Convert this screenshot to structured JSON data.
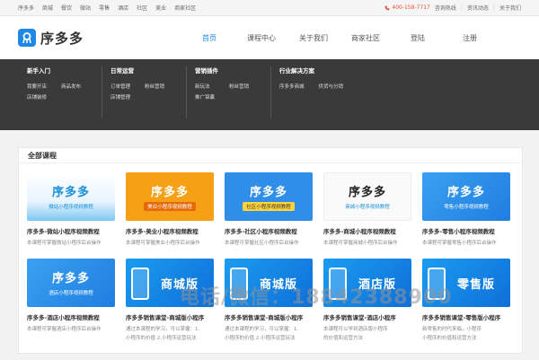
{
  "topbar": {
    "left_links": [
      "序多多",
      "商城",
      "餐饮",
      "微站",
      "零售",
      "酒店",
      "社区",
      "美业",
      "商家社区"
    ],
    "phone": "400-158-7717",
    "right_links": [
      "咨询热线",
      "资讯动态",
      "关于我们"
    ]
  },
  "header": {
    "logo_text": "序多多",
    "nav": [
      "首页",
      "课程中心",
      "关于我们",
      "商家社区",
      "登陆",
      "注册"
    ],
    "active_nav": "首页"
  },
  "mega_menu": {
    "columns": [
      {
        "title": "新手入门",
        "links": [
          "我要开店",
          "商品发布",
          "店铺装修"
        ]
      },
      {
        "title": "日常运营",
        "links": [
          "订单管理",
          "粉丝营销",
          "店铺管理"
        ]
      },
      {
        "title": "营销插件",
        "links": [
          "新玩法",
          "粉丝营销",
          "推广锦囊"
        ]
      },
      {
        "title": "行业解决方案",
        "links": [
          "序多多商城",
          "供货与分销"
        ]
      }
    ]
  },
  "content": {
    "section_title": "全部课程",
    "courses": [
      {
        "thumb_big": "序多多",
        "thumb_sub": "微站小程序视频教程",
        "title": "序多多-微站小程序视频教程",
        "desc": "本课程可掌握微站小程序后台操作",
        "desc2": ""
      },
      {
        "thumb_big": "序多多",
        "thumb_sub": "美业小程序视频教程",
        "title": "序多多-美业小程序视频教程",
        "desc": "本课程可掌握美业小程序后台操作",
        "desc2": ""
      },
      {
        "thumb_big": "序多多",
        "thumb_sub": "社区小程序视频教程",
        "title": "序多多-社区小程序视频教程",
        "desc": "本课程可掌握社区小程序后台操作",
        "desc2": ""
      },
      {
        "thumb_big": "序多多",
        "thumb_sub": "商城小程序视频教程",
        "title": "序多多-商城小程序视频教程",
        "desc": "本课程可掌握商城小程序后台操作",
        "desc2": ""
      },
      {
        "thumb_big": "序多多",
        "thumb_sub": "零售小程序视频教程",
        "title": "序多多-零售小程序视频教程",
        "desc": "本课程可掌握零售小程序后台操作",
        "desc2": ""
      },
      {
        "thumb_big": "序多多",
        "thumb_sub": "酒店小程序视频教程",
        "title": "序多多-酒店小程序视频教程",
        "desc": "本课程可掌握酒店小程序后台操作",
        "desc2": ""
      },
      {
        "thumb_big": "商城版",
        "thumb_sub": "",
        "title": "序多多销售课堂-商城版小程序",
        "desc": "通过本课程的学习，可以掌握：1.",
        "desc2": "小程序的价值 2.小程序运营玩法"
      },
      {
        "thumb_big": "商城版",
        "thumb_sub": "",
        "title": "序多多销售课堂-商城版小程序",
        "desc": "通过本课程的学习，可以掌握：1.",
        "desc2": "小程序的价值 2.小程序运营玩法"
      },
      {
        "thumb_big": "酒店版",
        "thumb_sub": "",
        "title": "序多多销售课堂-酒店小程序",
        "desc": "本课程可以学到酒店版小程序",
        "desc2": "的价值和运营方法"
      },
      {
        "thumb_big": "零售版",
        "thumb_sub": "",
        "title": "序多多销售课堂-零售版小程序",
        "desc": "新零售的时代来临，小程序",
        "desc2": "小程序的价值和运营方法"
      }
    ]
  },
  "watermark": "电话/微信：18842388900",
  "colors": {
    "accent": "#1e88e5",
    "phone": "#e8503a",
    "menu_bg": "#3a3a3a"
  }
}
